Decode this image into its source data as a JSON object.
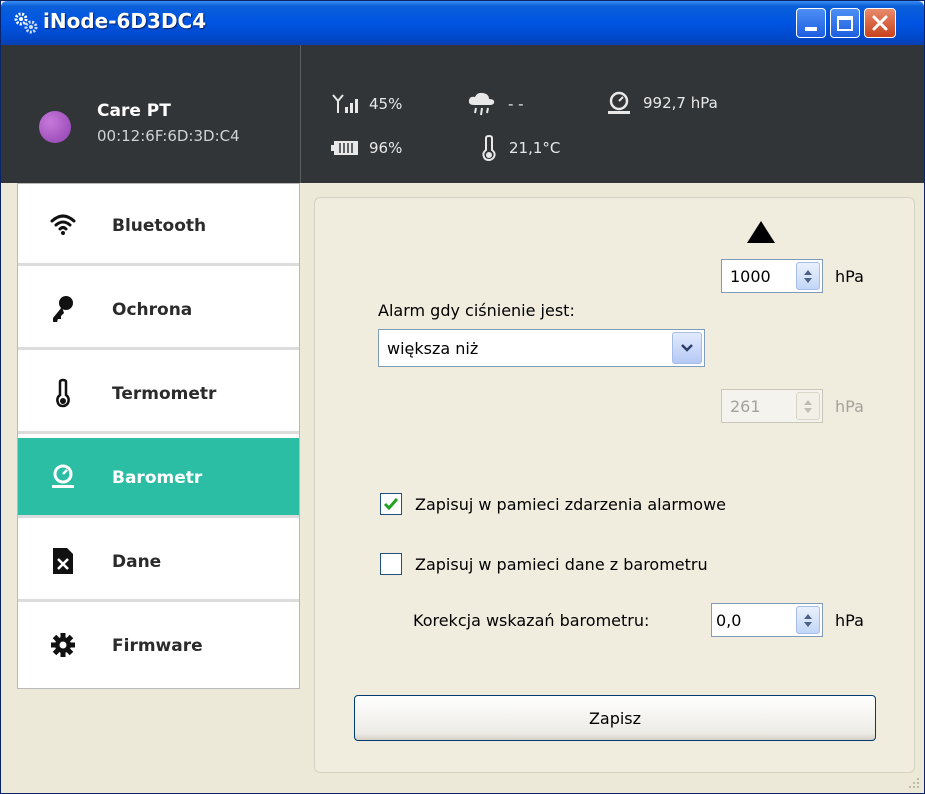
{
  "window": {
    "title": "iNode-6D3DC4"
  },
  "device": {
    "name": "Care PT",
    "mac": "00:12:6F:6D:3D:C4"
  },
  "stats": {
    "signal": "45%",
    "weather": "- -",
    "pressure": "992,7 hPa",
    "battery": "96%",
    "temperature": "21,1°C"
  },
  "sidebar": {
    "items": [
      {
        "label": "Bluetooth",
        "icon": "wifi-icon"
      },
      {
        "label": "Ochrona",
        "icon": "key-icon"
      },
      {
        "label": "Termometr",
        "icon": "thermometer-icon"
      },
      {
        "label": "Barometr",
        "icon": "barometer-icon",
        "active": true
      },
      {
        "label": "Dane",
        "icon": "file-delete-icon"
      },
      {
        "label": "Firmware",
        "icon": "gear-icon"
      }
    ]
  },
  "barometer": {
    "upper_value": "1000",
    "upper_unit": "hPa",
    "alarm_label": "Alarm gdy ciśnienie jest:",
    "condition": "większa niż",
    "lower_value": "261",
    "lower_unit": "hPa",
    "save_alarms_label": "Zapisuj w pamieci zdarzenia alarmowe",
    "save_alarms_checked": true,
    "save_data_label": "Zapisuj w pamieci dane z barometru",
    "save_data_checked": false,
    "correction_label": "Korekcja wskazań barometru:",
    "correction_value": "0,0",
    "correction_unit": "hPa",
    "save_button": "Zapisz"
  },
  "colors": {
    "accent": "#2bbea5",
    "header": "#313538",
    "titlebar": "#0054e3"
  }
}
